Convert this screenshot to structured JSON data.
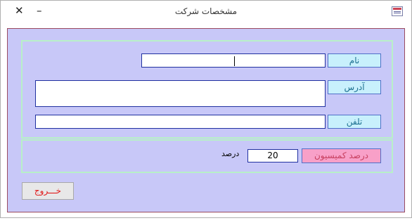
{
  "window": {
    "title": "مشخصات شرکت",
    "close_label": "✕",
    "minimize_label": "–"
  },
  "form": {
    "name_label": "نام",
    "name_value": "",
    "address_label": "آدرس",
    "address_value": "",
    "phone_label": "تلفن",
    "phone_value": "",
    "commission_label": "درصد کمیسیون",
    "commission_value": "20",
    "percent_text": "درصد",
    "exit_label": "خـــروج"
  },
  "colors": {
    "form_background": "#c8c8f8",
    "group_border": "#b8f0c8",
    "label_background": "#c8f0fc",
    "commission_label_background": "#f8a0c8",
    "exit_text": "#e01818"
  },
  "icons": {
    "window_icon": "form-icon",
    "close": "close-icon",
    "minimize": "minimize-icon"
  }
}
